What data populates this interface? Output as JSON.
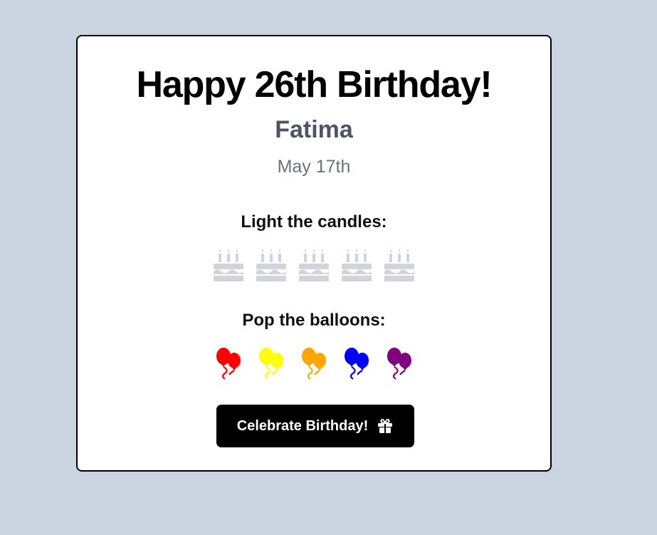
{
  "card": {
    "title": "Happy 26th Birthday!",
    "name": "Fatima",
    "date": "May 17th"
  },
  "candles": {
    "label": "Light the candles:",
    "count": 5,
    "icon": "birthday-cake-icon",
    "color": "#d1d5db"
  },
  "balloons": {
    "label": "Pop the balloons:",
    "icon": "balloons-icon",
    "colors": [
      "#ff0000",
      "#ffff00",
      "#ffa500",
      "#0000ff",
      "#800080"
    ]
  },
  "cta": {
    "label": "Celebrate Birthday!",
    "icon": "gift-icon"
  },
  "colors": {
    "background": "#cbd5e1",
    "card": "#ffffff",
    "button": "#000000"
  }
}
